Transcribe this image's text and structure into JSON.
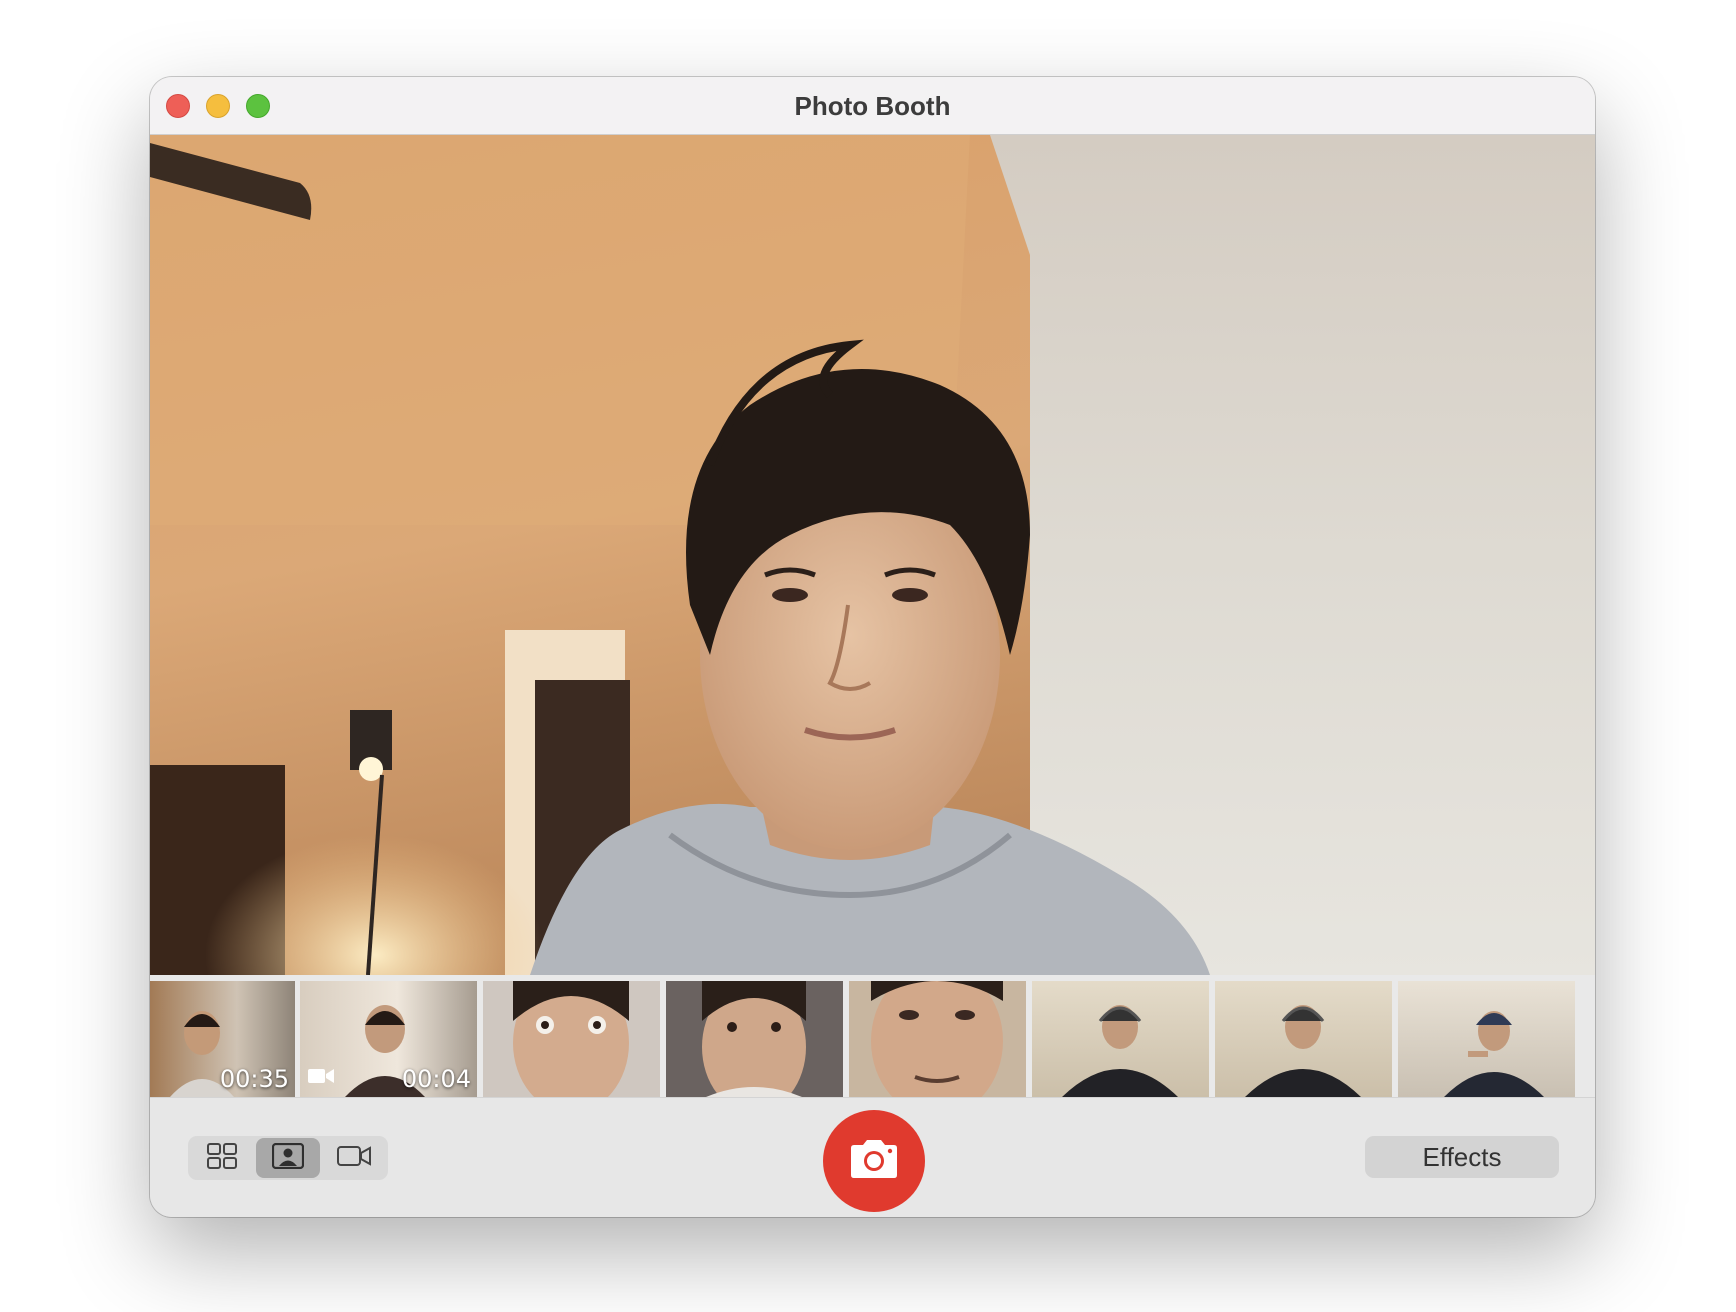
{
  "window": {
    "title": "Photo Booth"
  },
  "traffic_lights": [
    "close",
    "minimize",
    "zoom"
  ],
  "viewer": {
    "content": "live camera preview"
  },
  "thumbnails": [
    {
      "type": "video",
      "duration": "00:35",
      "scene": "warm-room"
    },
    {
      "type": "video",
      "duration": "00:04",
      "scene": "doorway"
    },
    {
      "type": "photo",
      "scene": "closeup-eyes-wide"
    },
    {
      "type": "photo",
      "scene": "closeup-kitchen"
    },
    {
      "type": "photo",
      "scene": "closeup-low-angle"
    },
    {
      "type": "photo",
      "scene": "headphones-room"
    },
    {
      "type": "photo",
      "scene": "headphones-room"
    },
    {
      "type": "photo",
      "scene": "headphones-pointing"
    }
  ],
  "toolbar": {
    "modes": [
      {
        "name": "four-up",
        "icon": "grid-icon",
        "active": false
      },
      {
        "name": "single-photo",
        "icon": "portrait-photo-icon",
        "active": true
      },
      {
        "name": "video",
        "icon": "video-camera-icon",
        "active": false
      }
    ],
    "shutter_icon": "camera-icon",
    "effects_label": "Effects"
  },
  "colors": {
    "shutter": "#e03a2e",
    "close": "#ee5f57",
    "minimize": "#f5be3e",
    "zoom": "#5cc23f"
  }
}
